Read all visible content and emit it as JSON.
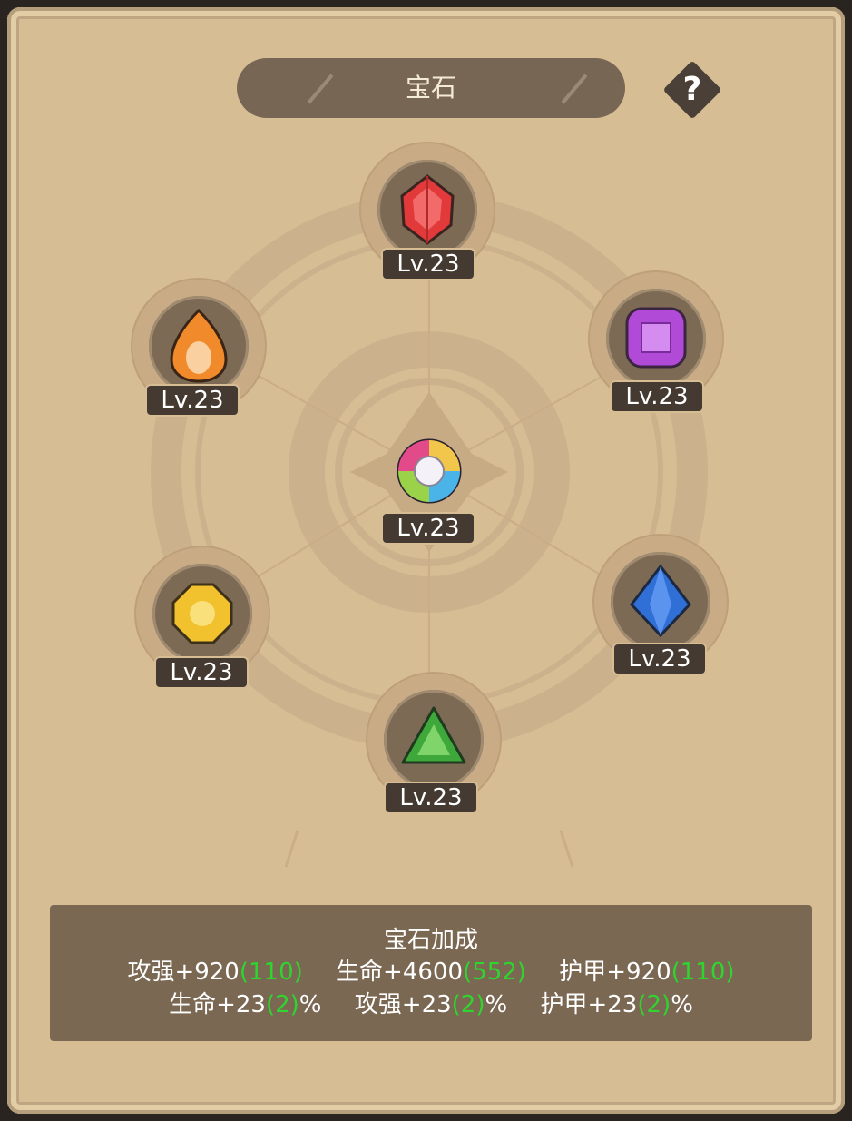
{
  "title": "宝石",
  "help_label": "?",
  "colors": {
    "panel": "#d7bd93",
    "bar": "#776653",
    "bonus_green": "#2fd42f"
  },
  "gems": [
    {
      "id": "red",
      "icon": "red-gem-icon",
      "level": "Lv.23",
      "color": "#e23a3a"
    },
    {
      "id": "purple",
      "icon": "purple-gem-icon",
      "level": "Lv.23",
      "color": "#b24ad8"
    },
    {
      "id": "blue",
      "icon": "blue-gem-icon",
      "level": "Lv.23",
      "color": "#2f6fd6"
    },
    {
      "id": "green",
      "icon": "green-gem-icon",
      "level": "Lv.23",
      "color": "#3ea83a"
    },
    {
      "id": "yellow",
      "icon": "yellow-gem-icon",
      "level": "Lv.23",
      "color": "#f1c12e"
    },
    {
      "id": "orange",
      "icon": "orange-gem-icon",
      "level": "Lv.23",
      "color": "#f08a2a"
    },
    {
      "id": "rainbow",
      "icon": "rainbow-gem-icon",
      "level": "Lv.23",
      "color": "#ffffff"
    }
  ],
  "bonus": {
    "title": "宝石加成",
    "row1": [
      {
        "label": "攻强+920",
        "bonus": "(110)",
        "suffix": ""
      },
      {
        "label": "生命+4600",
        "bonus": "(552)",
        "suffix": ""
      },
      {
        "label": "护甲+920",
        "bonus": "(110)",
        "suffix": ""
      }
    ],
    "row2": [
      {
        "label": "生命+23",
        "bonus": "(2)",
        "suffix": "%"
      },
      {
        "label": "攻强+23",
        "bonus": "(2)",
        "suffix": "%"
      },
      {
        "label": "护甲+23",
        "bonus": "(2)",
        "suffix": "%"
      }
    ]
  }
}
